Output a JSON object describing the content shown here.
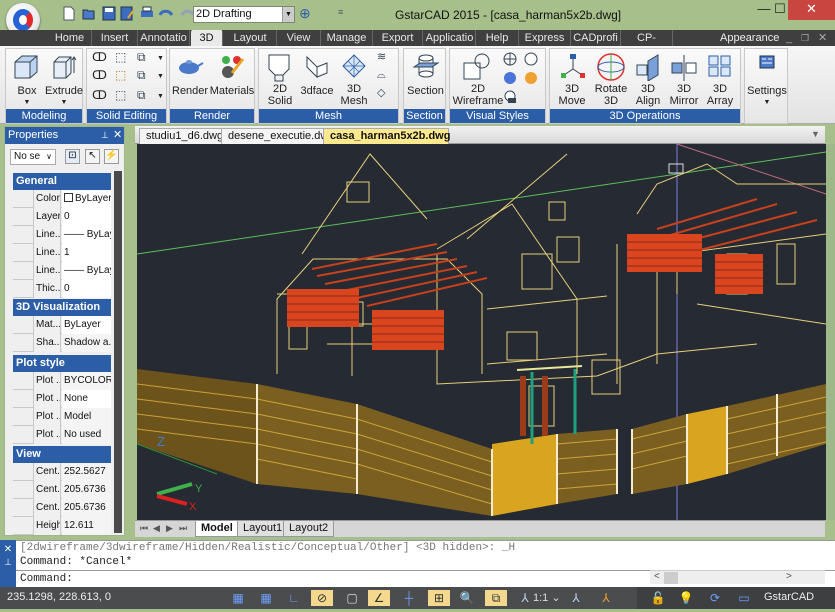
{
  "window": {
    "title": "GstarCAD 2015  - [casa_harman5x2b.dwg]",
    "minimize_icon": "minimize-icon",
    "maximize_icon": "maximize-icon",
    "close_icon": "close-icon",
    "close_glyph": "✕",
    "minimize_glyph": "—",
    "maximize_glyph": "☐"
  },
  "quick_access": {
    "items": [
      "new-icon",
      "open-icon",
      "save-icon",
      "save-as-icon",
      "print-icon",
      "undo-icon",
      "redo-icon"
    ],
    "workspace": "2D Drafting",
    "extra_icon": "snap-icon"
  },
  "ribbon": {
    "tabs": [
      "Home",
      "Insert",
      "Annotatio",
      "3D",
      "Layout",
      "View",
      "Manage",
      "Export",
      "Applicatio",
      "Help",
      "Express",
      "CADprofi",
      "CP-Symbol"
    ],
    "active_tab": "3D",
    "appearance": "Appearance",
    "panels": {
      "modeling": {
        "title": "Modeling",
        "buttons": [
          "Box",
          "Extrude"
        ]
      },
      "solid_editing": {
        "title": "Solid Editing"
      },
      "render": {
        "title": "Render",
        "buttons": [
          "Render",
          "Materials"
        ]
      },
      "mesh": {
        "title": "Mesh",
        "buttons": [
          "2D\nSolid",
          "3dface",
          "3D\nMesh"
        ],
        "b1a": "2D",
        "b1b": "Solid",
        "b3a": "3D",
        "b3b": "Mesh"
      },
      "section": {
        "title": "Section",
        "buttons": [
          "Section"
        ]
      },
      "visual_styles": {
        "title": "Visual Styles",
        "b1a": "2D",
        "b1b": "Wireframe"
      },
      "operations": {
        "title": "3D Operations",
        "buttons": [
          {
            "a": "3D",
            "b": "Move"
          },
          {
            "a": "Rotate",
            "b": "3D"
          },
          {
            "a": "3D",
            "b": "Align"
          },
          {
            "a": "3D",
            "b": "Mirror"
          },
          {
            "a": "3D",
            "b": "Array"
          }
        ]
      },
      "settings": {
        "label": "Settings"
      }
    }
  },
  "properties": {
    "title": "Properties",
    "selection": "No se",
    "sections": {
      "general": {
        "title": "General",
        "rows": [
          {
            "k": "Color",
            "v": "ByLayer"
          },
          {
            "k": "Layer",
            "v": "0"
          },
          {
            "k": "Line...",
            "v": "—— ByLay"
          },
          {
            "k": "Line...",
            "v": "1"
          },
          {
            "k": "Line...",
            "v": "—— ByLay"
          },
          {
            "k": "Thic...",
            "v": "0"
          }
        ]
      },
      "viz": {
        "title": "3D Visualization",
        "rows": [
          {
            "k": "Mat...",
            "v": "ByLayer"
          },
          {
            "k": "Sha...",
            "v": "Shadow a..."
          }
        ]
      },
      "plot": {
        "title": "Plot style",
        "rows": [
          {
            "k": "Plot ...",
            "v": "BYCOLOR"
          },
          {
            "k": "Plot ...",
            "v": "None"
          },
          {
            "k": "Plot ...",
            "v": "Model"
          },
          {
            "k": "Plot ...",
            "v": "No used"
          }
        ]
      },
      "view": {
        "title": "View",
        "rows": [
          {
            "k": "Cent...",
            "v": "252.5627"
          },
          {
            "k": "Cent...",
            "v": "205.6736"
          },
          {
            "k": "Cent...",
            "v": "205.6736"
          },
          {
            "k": "Height",
            "v": "12.611"
          }
        ]
      }
    }
  },
  "documents": {
    "tabs": [
      "studiu1_d6.dwg",
      "desene_executie.dwg",
      "casa_harman5x2b.dwg"
    ],
    "active": "casa_harman5x2b.dwg",
    "close_glyph": "×"
  },
  "viewport": {
    "ucs_labels": {
      "z": "Z",
      "y": "Y",
      "x": "X"
    },
    "colors": {
      "background": "#252a33",
      "wire": "#e8d07a",
      "rail": "#d8451f",
      "fence": "#d9a520",
      "ground": "#4caf50"
    }
  },
  "layout_tabs": {
    "tabs": [
      "Model",
      "Layout1",
      "Layout2"
    ],
    "active": "Model"
  },
  "command": {
    "lines": [
      "[2dwireframe/3dwireframe/Hidden/Realistic/Conceptual/Other] <3D hidden>: _H",
      "Command: *Cancel*"
    ],
    "prompt": "Command:"
  },
  "status": {
    "coordinates": "235.1298, 228.613, 0",
    "scale": "1:1",
    "app_label": "GstarCAD",
    "toggles": [
      {
        "name": "snap-grid-icon",
        "on": false
      },
      {
        "name": "grid-icon",
        "on": false
      },
      {
        "name": "ortho-icon",
        "on": false
      },
      {
        "name": "polar-icon",
        "on": true
      },
      {
        "name": "osnap-icon",
        "on": false
      },
      {
        "name": "otrack-icon",
        "on": true
      },
      {
        "name": "ducs-icon",
        "on": false
      },
      {
        "name": "dyn-icon",
        "on": true
      },
      {
        "name": "quick-props-icon",
        "on": false
      },
      {
        "name": "sel-cycling-icon",
        "on": true
      }
    ]
  }
}
